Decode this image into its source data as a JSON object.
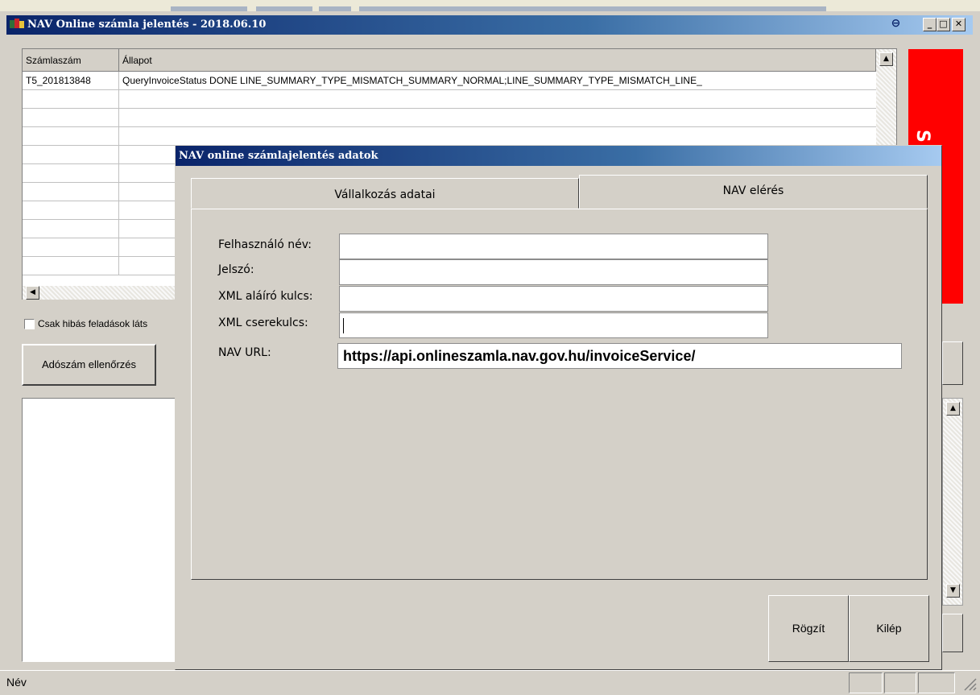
{
  "main_window": {
    "title": "NAV Online számla jelentés - 2018.06.10",
    "title_buttons": [
      "⊖",
      "_",
      "□",
      "✕"
    ]
  },
  "grid": {
    "columns": [
      "Számlaszám",
      "Állapot"
    ],
    "rows": [
      [
        "T5_201813848",
        "QueryInvoiceStatus DONE LINE_SUMMARY_TYPE_MISMATCH_SUMMARY_NORMAL;LINE_SUMMARY_TYPE_MISMATCH_LINE_"
      ],
      [
        "",
        ""
      ],
      [
        "",
        ""
      ],
      [
        "",
        ""
      ],
      [
        "",
        ""
      ],
      [
        "",
        ""
      ],
      [
        "",
        ""
      ],
      [
        "",
        ""
      ],
      [
        "",
        ""
      ],
      [
        "",
        ""
      ],
      [
        "",
        ""
      ]
    ]
  },
  "red_panel_text": "S",
  "checkbox_label": "Csak hibás feladások láts",
  "adoszam_button": "Adószám ellenőrzés",
  "status_bar": {
    "text": "Név"
  },
  "dialog": {
    "title": "NAV online számlajelentés adatok",
    "tabs": [
      "Vállalkozás adatai",
      "NAV elérés"
    ],
    "fields": {
      "username_label": "Felhasználó név:",
      "username_value": "",
      "password_label": "Jelszó:",
      "password_value": "",
      "sign_key_label": "XML aláíró kulcs:",
      "sign_key_value": "",
      "exchange_key_label": "XML cserekulcs:",
      "exchange_key_value": "",
      "url_label": "NAV URL:",
      "url_value": "https://api.onlineszamla.nav.gov.hu/invoiceService/"
    },
    "buttons": {
      "save": "Rögzít",
      "exit": "Kilép"
    }
  },
  "colors": {
    "title_bar": "#0a246a",
    "window_bg": "#d4d0c8",
    "alert_panel": "#ff0000"
  }
}
